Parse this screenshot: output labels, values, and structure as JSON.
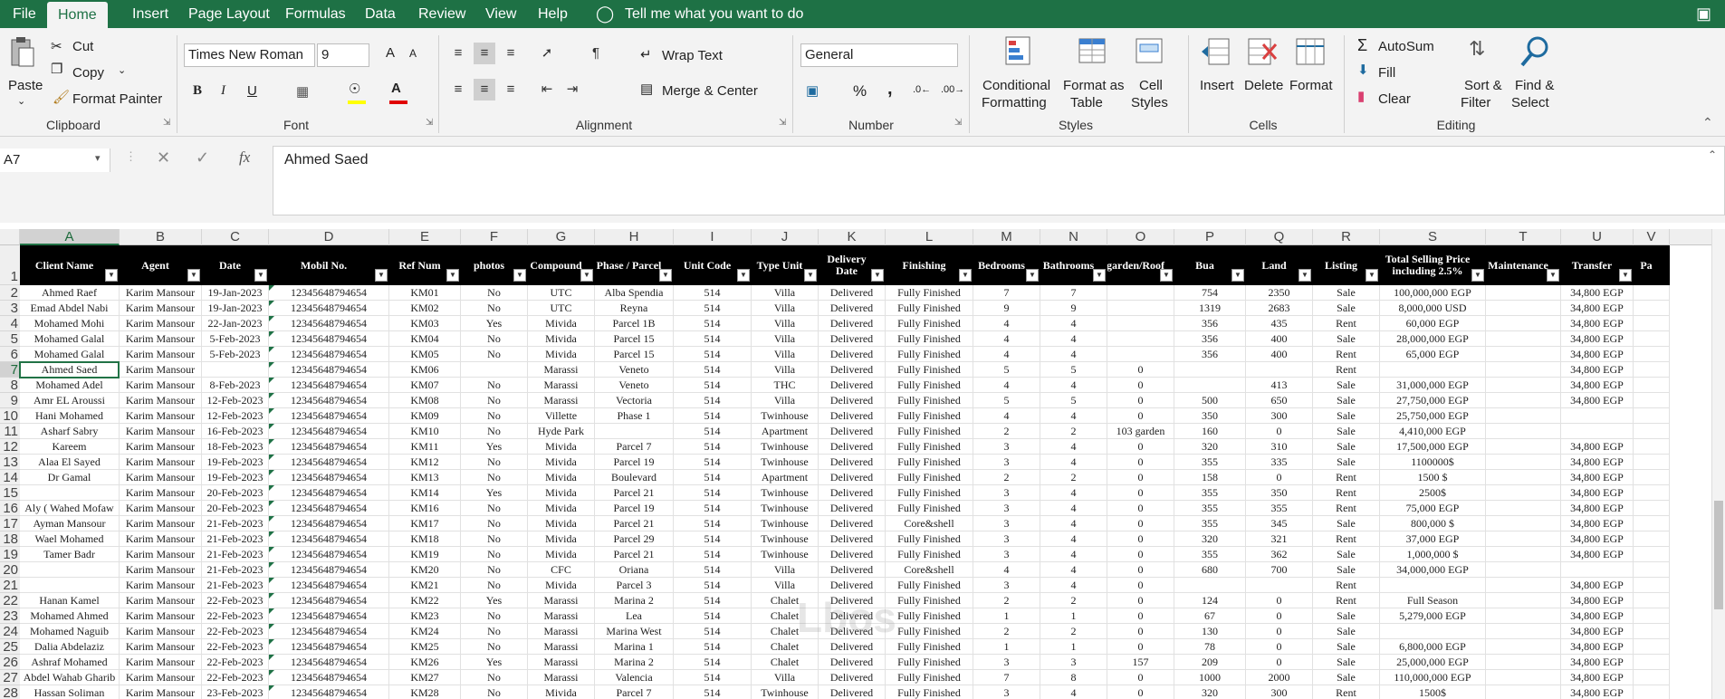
{
  "tabs": {
    "file": "File",
    "home": "Home",
    "insert": "Insert",
    "page_layout": "Page Layout",
    "formulas": "Formulas",
    "data": "Data",
    "review": "Review",
    "view": "View",
    "help": "Help",
    "tell_me": "Tell me what you want to do"
  },
  "clipboard": {
    "paste": "Paste",
    "cut": "Cut",
    "copy": "Copy",
    "format_painter": "Format Painter",
    "label": "Clipboard"
  },
  "font": {
    "name": "Times New Roman",
    "size": "9",
    "label": "Font",
    "bold": "B",
    "italic": "I",
    "underline": "U",
    "grow": "A",
    "shrink": "A"
  },
  "alignment": {
    "wrap_text": "Wrap Text",
    "merge_center": "Merge & Center",
    "label": "Alignment"
  },
  "number": {
    "format": "General",
    "percent": "%",
    "comma": ",",
    "label": "Number"
  },
  "styles": {
    "conditional": "Conditional",
    "conditional2": "Formatting",
    "format_as": "Format as",
    "format_as2": "Table",
    "cell_styles": "Cell",
    "cell_styles2": "Styles",
    "label": "Styles"
  },
  "cells": {
    "insert": "Insert",
    "delete": "Delete",
    "format": "Format",
    "label": "Cells"
  },
  "editing": {
    "autosum": "AutoSum",
    "fill": "Fill",
    "clear": "Clear",
    "sort_filter": "Sort &",
    "sort_filter2": "Filter",
    "find_select": "Find &",
    "find_select2": "Select",
    "label": "Editing"
  },
  "formula_bar": {
    "name_box": "A7",
    "content": "Ahmed Saed",
    "fx": "fx"
  },
  "columns": [
    "A",
    "B",
    "C",
    "D",
    "E",
    "F",
    "G",
    "H",
    "I",
    "J",
    "K",
    "L",
    "M",
    "N",
    "O",
    "P",
    "Q",
    "R",
    "S",
    "T",
    "U",
    "V"
  ],
  "headers": [
    "Client Name",
    "Agent",
    "Date",
    "Mobil No.",
    "Ref Num",
    "photos",
    "Compound",
    "Phase / Parcel",
    "Unit Code",
    "Type Unit",
    "Delivery Date",
    "Finishing",
    "Bedrooms",
    "Bathrooms",
    "garden/Roof",
    "Bua",
    "Land",
    "Listing",
    "Total Selling Price including 2.5%",
    "Maintenance",
    "Transfer",
    "Pa"
  ],
  "rows": [
    [
      "Ahmed Raef",
      "Karim Mansour",
      "19-Jan-2023",
      "12345648794654",
      "KM01",
      "No",
      "UTC",
      "Alba Spendia",
      "514",
      "Villa",
      "Delivered",
      "Fully Finished",
      "7",
      "7",
      "",
      "754",
      "2350",
      "Sale",
      "100,000,000 EGP",
      "",
      "34,800 EGP"
    ],
    [
      "Emad Abdel Nabi",
      "Karim Mansour",
      "19-Jan-2023",
      "12345648794654",
      "KM02",
      "No",
      "UTC",
      "Reyna",
      "514",
      "Villa",
      "Delivered",
      "Fully Finished",
      "9",
      "9",
      "",
      "1319",
      "2683",
      "Sale",
      "8,000,000 USD",
      "",
      "34,800 EGP"
    ],
    [
      "Mohamed Mohi",
      "Karim Mansour",
      "22-Jan-2023",
      "12345648794654",
      "KM03",
      "Yes",
      "Mivida",
      "Parcel 1B",
      "514",
      "Villa",
      "Delivered",
      "Fully Finished",
      "4",
      "4",
      "",
      "356",
      "435",
      "Rent",
      "60,000 EGP",
      "",
      "34,800 EGP"
    ],
    [
      "Mohamed Galal",
      "Karim Mansour",
      "5-Feb-2023",
      "12345648794654",
      "KM04",
      "No",
      "Mivida",
      "Parcel 15",
      "514",
      "Villa",
      "Delivered",
      "Fully Finished",
      "4",
      "4",
      "",
      "356",
      "400",
      "Sale",
      "28,000,000 EGP",
      "",
      "34,800 EGP"
    ],
    [
      "Mohamed Galal",
      "Karim Mansour",
      "5-Feb-2023",
      "12345648794654",
      "KM05",
      "No",
      "Mivida",
      "Parcel 15",
      "514",
      "Villa",
      "Delivered",
      "Fully Finished",
      "4",
      "4",
      "",
      "356",
      "400",
      "Rent",
      "65,000 EGP",
      "",
      "34,800 EGP"
    ],
    [
      "Ahmed Saed",
      "Karim Mansour",
      "",
      "12345648794654",
      "KM06",
      "",
      "Marassi",
      "Veneto",
      "514",
      "Villa",
      "Delivered",
      "Fully Finished",
      "5",
      "5",
      "0",
      "",
      "",
      "Rent",
      "",
      "",
      "34,800 EGP"
    ],
    [
      "Mohamed Adel",
      "Karim Mansour",
      "8-Feb-2023",
      "12345648794654",
      "KM07",
      "No",
      "Marassi",
      "Veneto",
      "514",
      "THC",
      "Delivered",
      "Fully Finished",
      "4",
      "4",
      "0",
      "",
      "413",
      "Sale",
      "31,000,000 EGP",
      "",
      "34,800 EGP"
    ],
    [
      "Amr EL Aroussi",
      "Karim Mansour",
      "12-Feb-2023",
      "12345648794654",
      "KM08",
      "No",
      "Marassi",
      "Vectoria",
      "514",
      "Villa",
      "Delivered",
      "Fully Finished",
      "5",
      "5",
      "0",
      "500",
      "650",
      "Sale",
      "27,750,000 EGP",
      "",
      "34,800 EGP"
    ],
    [
      "Hani Mohamed",
      "Karim Mansour",
      "12-Feb-2023",
      "12345648794654",
      "KM09",
      "No",
      "Villette",
      "Phase 1",
      "514",
      "Twinhouse",
      "Delivered",
      "Fully Finished",
      "4",
      "4",
      "0",
      "350",
      "300",
      "Sale",
      "25,750,000 EGP",
      "",
      ""
    ],
    [
      "Asharf Sabry",
      "Karim Mansour",
      "16-Feb-2023",
      "12345648794654",
      "KM10",
      "No",
      "Hyde Park",
      "",
      "514",
      "Apartment",
      "Delivered",
      "Fully Finished",
      "2",
      "2",
      "103 garden",
      "160",
      "0",
      "Sale",
      "4,410,000 EGP",
      "",
      ""
    ],
    [
      "Kareem",
      "Karim Mansour",
      "18-Feb-2023",
      "12345648794654",
      "KM11",
      "Yes",
      "Mivida",
      "Parcel 7",
      "514",
      "Twinhouse",
      "Delivered",
      "Fully Finished",
      "3",
      "4",
      "0",
      "320",
      "310",
      "Sale",
      "17,500,000 EGP",
      "",
      "34,800 EGP"
    ],
    [
      "Alaa El Sayed",
      "Karim Mansour",
      "19-Feb-2023",
      "12345648794654",
      "KM12",
      "No",
      "Mivida",
      "Parcel 19",
      "514",
      "Twinhouse",
      "Delivered",
      "Fully Finished",
      "3",
      "4",
      "0",
      "355",
      "335",
      "Sale",
      "1100000$",
      "",
      "34,800 EGP"
    ],
    [
      "Dr Gamal",
      "Karim Mansour",
      "19-Feb-2023",
      "12345648794654",
      "KM13",
      "No",
      "Mivida",
      "Boulevard",
      "514",
      "Apartment",
      "Delivered",
      "Fully Finished",
      "2",
      "2",
      "0",
      "158",
      "0",
      "Rent",
      "1500 $",
      "",
      "34,800 EGP"
    ],
    [
      "",
      "Karim Mansour",
      "20-Feb-2023",
      "12345648794654",
      "KM14",
      "Yes",
      "Mivida",
      "Parcel 21",
      "514",
      "Twinhouse",
      "Delivered",
      "Fully Finished",
      "3",
      "4",
      "0",
      "355",
      "350",
      "Rent",
      "2500$",
      "",
      "34,800 EGP"
    ],
    [
      "Aly ( Wahed Mofaw",
      "Karim Mansour",
      "20-Feb-2023",
      "12345648794654",
      "KM16",
      "No",
      "Mivida",
      "Parcel 19",
      "514",
      "Twinhouse",
      "Delivered",
      "Fully Finished",
      "3",
      "4",
      "0",
      "355",
      "355",
      "Rent",
      "75,000 EGP",
      "",
      "34,800 EGP"
    ],
    [
      "Ayman Mansour",
      "Karim Mansour",
      "21-Feb-2023",
      "12345648794654",
      "KM17",
      "No",
      "Mivida",
      "Parcel 21",
      "514",
      "Twinhouse",
      "Delivered",
      "Core&shell",
      "3",
      "4",
      "0",
      "355",
      "345",
      "Sale",
      "800,000 $",
      "",
      "34,800 EGP"
    ],
    [
      "Wael Mohamed",
      "Karim Mansour",
      "21-Feb-2023",
      "12345648794654",
      "KM18",
      "No",
      "Mivida",
      "Parcel 29",
      "514",
      "Twinhouse",
      "Delivered",
      "Fully Finished",
      "3",
      "4",
      "0",
      "320",
      "321",
      "Rent",
      "37,000 EGP",
      "",
      "34,800 EGP"
    ],
    [
      "Tamer Badr",
      "Karim Mansour",
      "21-Feb-2023",
      "12345648794654",
      "KM19",
      "No",
      "Mivida",
      "Parcel 21",
      "514",
      "Twinhouse",
      "Delivered",
      "Fully Finished",
      "3",
      "4",
      "0",
      "355",
      "362",
      "Sale",
      "1,000,000 $",
      "",
      "34,800 EGP"
    ],
    [
      "",
      "Karim Mansour",
      "21-Feb-2023",
      "12345648794654",
      "KM20",
      "No",
      "CFC",
      "Oriana",
      "514",
      "Villa",
      "Delivered",
      "Core&shell",
      "4",
      "4",
      "0",
      "680",
      "700",
      "Sale",
      "34,000,000 EGP",
      "",
      ""
    ],
    [
      "",
      "Karim Mansour",
      "21-Feb-2023",
      "12345648794654",
      "KM21",
      "No",
      "Mivida",
      "Parcel 3",
      "514",
      "Villa",
      "Delivered",
      "Fully Finished",
      "3",
      "4",
      "0",
      "",
      "",
      "Rent",
      "",
      "",
      "34,800 EGP"
    ],
    [
      "Hanan Kamel",
      "Karim Mansour",
      "22-Feb-2023",
      "12345648794654",
      "KM22",
      "Yes",
      "Marassi",
      "Marina 2",
      "514",
      "Chalet",
      "Delivered",
      "Fully Finished",
      "2",
      "2",
      "0",
      "124",
      "0",
      "Rent",
      "Full Season",
      "",
      "34,800 EGP"
    ],
    [
      "Mohamed Ahmed",
      "Karim Mansour",
      "22-Feb-2023",
      "12345648794654",
      "KM23",
      "No",
      "Marassi",
      "Lea",
      "514",
      "Chalet",
      "Delivered",
      "Fully Finished",
      "1",
      "1",
      "0",
      "67",
      "0",
      "Sale",
      "5,279,000 EGP",
      "",
      "34,800 EGP"
    ],
    [
      "Mohamed Naguib",
      "Karim Mansour",
      "22-Feb-2023",
      "12345648794654",
      "KM24",
      "No",
      "Marassi",
      "Marina West",
      "514",
      "Chalet",
      "Delivered",
      "Fully Finished",
      "2",
      "2",
      "0",
      "130",
      "0",
      "Sale",
      "",
      "",
      "34,800 EGP"
    ],
    [
      "Dalia Abdelaziz",
      "Karim Mansour",
      "22-Feb-2023",
      "12345648794654",
      "KM25",
      "No",
      "Marassi",
      "Marina 1",
      "514",
      "Chalet",
      "Delivered",
      "Fully Finished",
      "1",
      "1",
      "0",
      "78",
      "0",
      "Sale",
      "6,800,000 EGP",
      "",
      "34,800 EGP"
    ],
    [
      "Ashraf Mohamed",
      "Karim Mansour",
      "22-Feb-2023",
      "12345648794654",
      "KM26",
      "Yes",
      "Marassi",
      "Marina 2",
      "514",
      "Chalet",
      "Delivered",
      "Fully Finished",
      "3",
      "3",
      "157",
      "209",
      "0",
      "Sale",
      "25,000,000 EGP",
      "",
      "34,800 EGP"
    ],
    [
      "Abdel Wahab Gharib",
      "Karim Mansour",
      "22-Feb-2023",
      "12345648794654",
      "KM27",
      "No",
      "Marassi",
      "Valencia",
      "514",
      "Villa",
      "Delivered",
      "Fully Finished",
      "7",
      "8",
      "0",
      "1000",
      "2000",
      "Sale",
      "110,000,000 EGP",
      "",
      "34,800 EGP"
    ],
    [
      "Hassan Soliman",
      "Karim Mansour",
      "23-Feb-2023",
      "12345648794654",
      "KM28",
      "No",
      "Mivida",
      "Parcel 7",
      "514",
      "Twinhouse",
      "Delivered",
      "Fully Finished",
      "3",
      "4",
      "0",
      "320",
      "300",
      "Rent",
      "1500$",
      "",
      "34,800 EGP"
    ]
  ],
  "watermark": "Lbos"
}
